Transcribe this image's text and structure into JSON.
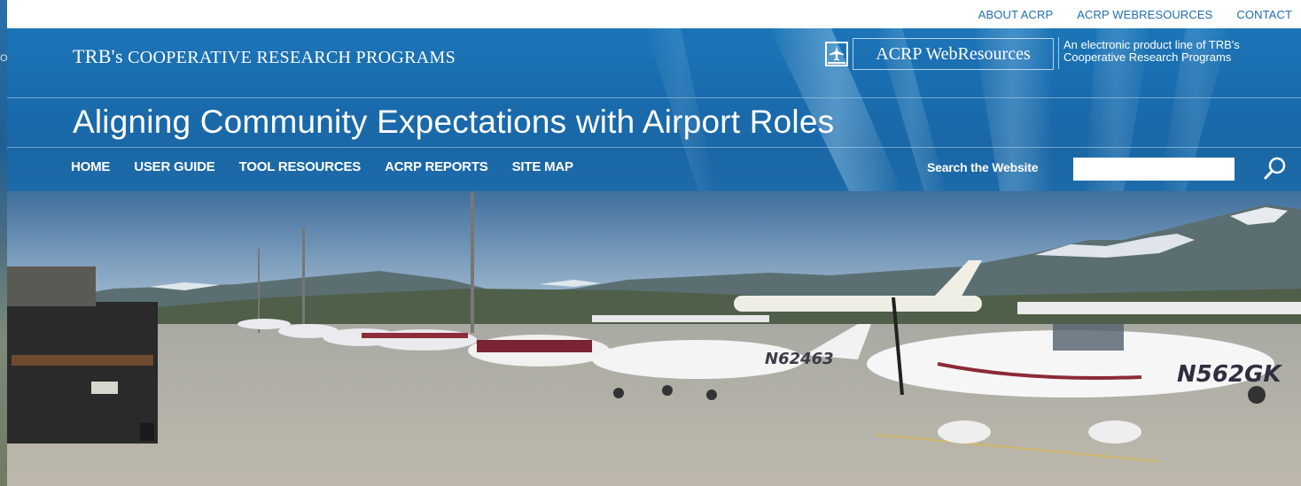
{
  "top_links": [
    "ABOUT ACRP",
    "ACRP WEBRESOURCES",
    "CONTACT"
  ],
  "left_strip_fragment": "O",
  "header": {
    "org_title_prefix": "TRB's",
    "org_title_rest": "COOPERATIVE RESEARCH PROGRAMS",
    "product_name": "ACRP WebResources",
    "tagline_line1": "An electronic product line of TRB's",
    "tagline_line2": "Cooperative Research Programs",
    "page_title": "Aligning Community Expectations with Airport Roles"
  },
  "nav": [
    "HOME",
    "USER GUIDE",
    "TOOL RESOURCES",
    "ACRP REPORTS",
    "SITE MAP"
  ],
  "search": {
    "label": "Search the Website",
    "value": ""
  },
  "hero": {
    "tail_numbers": [
      "N62463",
      "N562GK"
    ]
  },
  "icons": {
    "product_icon": "book-airplane-icon",
    "search_icon": "magnifier-icon"
  },
  "colors": {
    "header_blue": "#1a6cae",
    "link_blue": "#1e6db3"
  }
}
